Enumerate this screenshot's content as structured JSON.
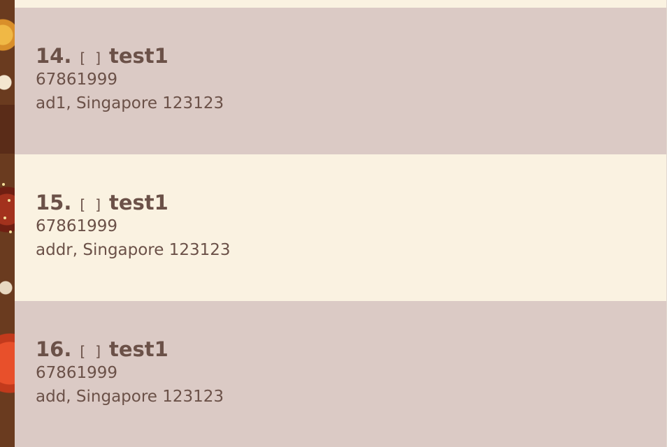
{
  "persons": [
    {
      "index": "14.",
      "tag_open": "[",
      "tag_close": "]",
      "name": "test1",
      "phone": "67861999",
      "address": "ad1, Singapore 123123"
    },
    {
      "index": "15.",
      "tag_open": "[",
      "tag_close": "]",
      "name": "test1",
      "phone": "67861999",
      "address": "addr, Singapore 123123"
    },
    {
      "index": "16.",
      "tag_open": "[",
      "tag_close": "]",
      "name": "test1",
      "phone": "67861999",
      "address": "add, Singapore 123123"
    }
  ],
  "colors": {
    "card_alt": "#dbcac5",
    "card_light": "#faf2e1",
    "text": "#6b5148"
  }
}
